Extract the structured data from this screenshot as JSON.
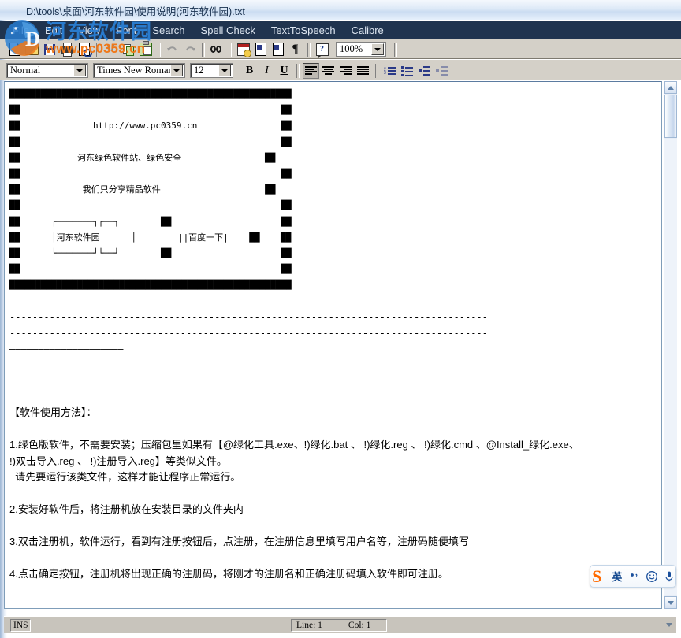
{
  "window": {
    "title": "D:\\tools\\桌面\\河东软件园\\使用说明(河东软件园).txt"
  },
  "menu": {
    "items": [
      {
        "label": "File"
      },
      {
        "label": "Edit"
      },
      {
        "label": "View"
      },
      {
        "label": "Font"
      },
      {
        "label": "Search"
      },
      {
        "label": "Spell Check"
      },
      {
        "label": "TextToSpeech"
      },
      {
        "label": "Calibre"
      }
    ]
  },
  "toolbar": {
    "icons": [
      "new-document-icon",
      "open-folder-icon",
      "save-icon",
      "print-icon",
      "print-preview-icon",
      "cut-icon",
      "copy-icon",
      "paste-icon",
      "undo-icon",
      "redo-icon",
      "find-icon",
      "insert-datetime-icon",
      "page-setup-icon",
      "page-break-icon",
      "pilcrow-icon",
      "help-icon"
    ],
    "zoom_value": "100%"
  },
  "formatbar": {
    "style_value": "Normal",
    "font_value": "Times New Roman",
    "size_value": "12",
    "bold_label": "B",
    "italic_label": "I",
    "underline_label": "U"
  },
  "document": {
    "art": [
      "██████████████████████████████████████████████████████",
      "██                                                  ██",
      "██              http://www.pc0359.cn                ██",
      "██                                                  ██",
      "██           河东绿色软件站、绿色安全                ██",
      "██                                                  ██",
      "██            我们只分享精品软件                    ██",
      "██                                                  ██",
      "██      ┌───────┐┌──┐        ██                     ██",
      "██      │河东软件园      │        ||百度一下|    ██    ██",
      "██      └───────┘└──┘        ██                     ██",
      "██                                                  ██",
      "██                                                  ██",
      "██████████████████████████████████████████████████████"
    ],
    "separators": [
      "————————————————————",
      "------------------------------------------------------------------------------------",
      "------------------------------------------------------------------------------------",
      "————————————————————"
    ],
    "heading": "【软件使用方法】：",
    "paragraphs": [
      "1.绿色版软件，不需要安装；压缩包里如果有【@绿化工具.exe、!)绿化.bat 、 !)绿化.reg 、 !)绿化.cmd 、@Install_绿化.exe、",
      "!)双击导入.reg 、 !)注册导入.reg】等类似文件。",
      "  请先要运行该类文件，这样才能让程序正常运行。",
      "2.安装好软件后，将注册机放在安装目录的文件夹内",
      "3.双击注册机，软件运行，看到有注册按钮后，点注册，在注册信息里填写用户名等，注册码随便填写",
      "4.点击确定按钮，注册机将出现正确的注册码，将刚才的注册名和正确注册码填入软件即可注册。"
    ]
  },
  "statusbar": {
    "insert_mode": "INS",
    "line_label": "Line: 1",
    "col_label": "Col: 1"
  },
  "watermark": {
    "site_name": "河东软件园",
    "site_url": "www.pc0359.cn"
  },
  "ime": {
    "logo": "S",
    "mode": "英",
    "punctuation_icon": "punctuation-icon",
    "emoji_icon": "smiley-icon",
    "voice_icon": "microphone-icon"
  },
  "colors": {
    "menu_bg": "#20344f",
    "toolbar_bg": "#d4d0c8",
    "accent_blue": "#2a7fd4",
    "accent_orange": "#f07818"
  }
}
